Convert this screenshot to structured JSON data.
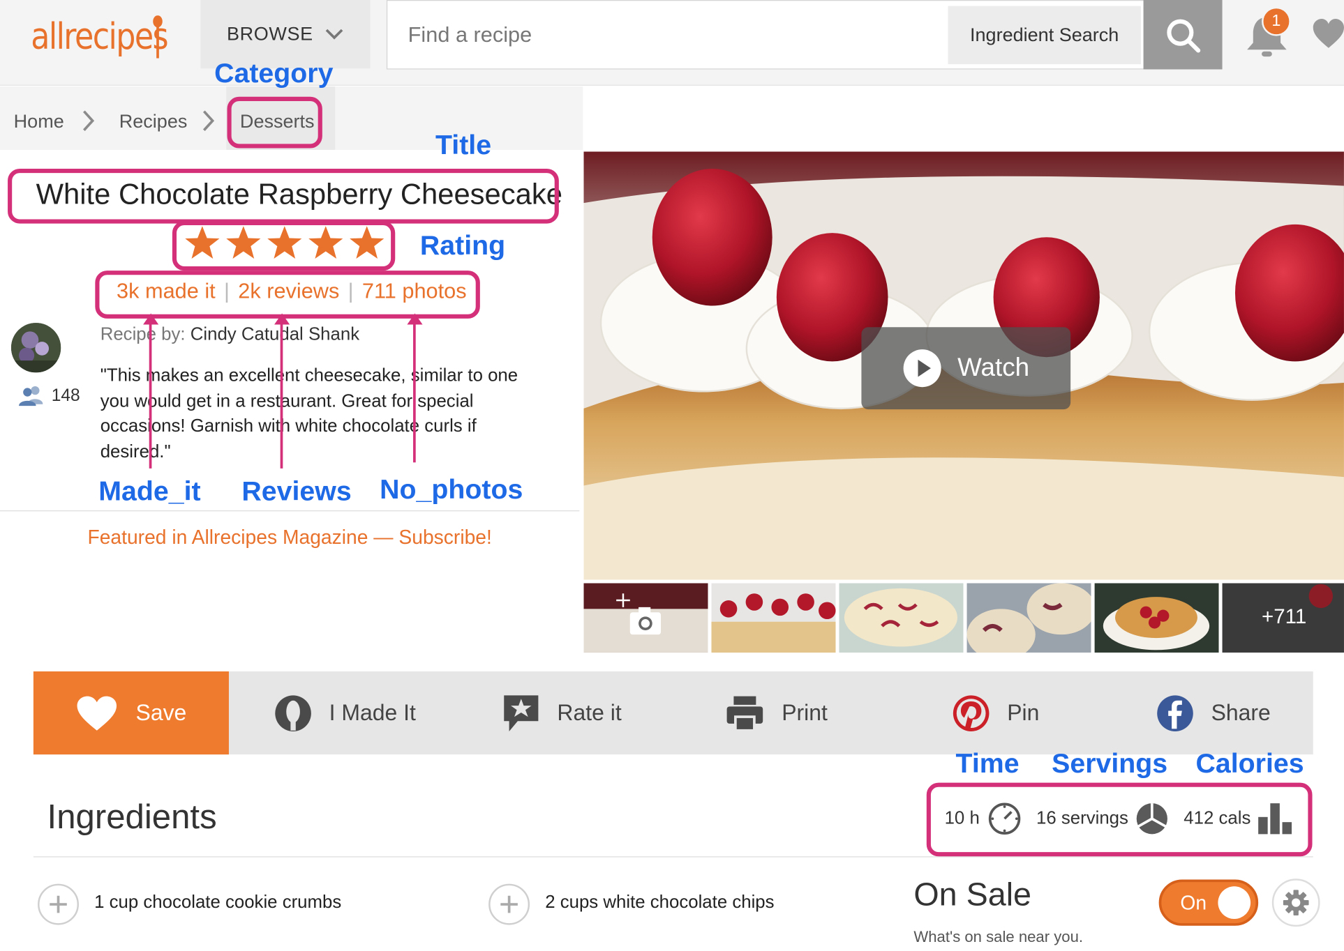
{
  "header": {
    "logo": "allrecipes",
    "browse_label": "BROWSE",
    "search_placeholder": "Find a recipe",
    "ingredient_search_label": "Ingredient Search",
    "notification_count": "1"
  },
  "breadcrumb": {
    "home": "Home",
    "recipes": "Recipes",
    "current": "Desserts"
  },
  "recipe": {
    "title": "White Chocolate Raspberry Cheesecake",
    "rating_stars": 5,
    "made_it": "3k made it",
    "reviews": "2k reviews",
    "photos": "711 photos",
    "recipe_by_label": "Recipe by:",
    "author": "Cindy Catudal Shank",
    "followers": "148",
    "description": "\"This makes an excellent cheesecake, similar to one you would get in a restaurant. Great for special occasions! Garnish with white chocolate curls if desired.\"",
    "featured": "Featured in Allrecipes Magazine — Subscribe!"
  },
  "media": {
    "watch_label": "Watch",
    "more_photos": "+711"
  },
  "actions": {
    "save": "Save",
    "made_it": "I Made It",
    "rate": "Rate it",
    "print": "Print",
    "pin": "Pin",
    "share": "Share"
  },
  "ingredients": {
    "heading": "Ingredients",
    "time": "10 h",
    "servings": "16 servings",
    "calories": "412 cals",
    "items": [
      "1 cup chocolate cookie crumbs",
      "2 cups white chocolate chips"
    ]
  },
  "on_sale": {
    "heading": "On Sale",
    "subtitle": "What's on sale near you.",
    "toggle_label": "On"
  },
  "annotations": {
    "category": "Category",
    "title": "Title",
    "rating": "Rating",
    "made_it": "Made_it",
    "reviews": "Reviews",
    "no_photos": "No_photos",
    "time": "Time",
    "servings": "Servings",
    "calories": "Calories"
  },
  "colors": {
    "brand_orange": "#e8712b",
    "annotation_blue": "#1e6ae6",
    "annotation_pink": "#d4307a",
    "pinterest_red": "#cb2027",
    "facebook_blue": "#3b5998"
  }
}
